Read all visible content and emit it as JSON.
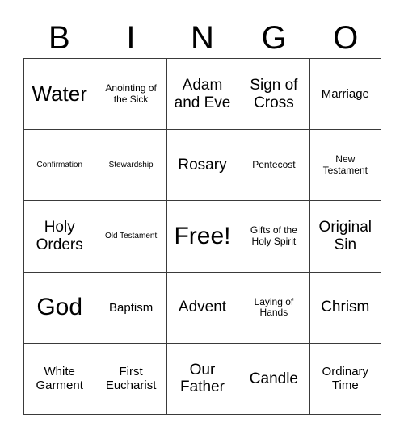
{
  "card": {
    "title": "BINGO",
    "header_letters": [
      "B",
      "I",
      "N",
      "G",
      "O"
    ],
    "grid_size": "5x5",
    "free_space": "Free!",
    "colors": {
      "background": "#ffffff",
      "text": "#000000",
      "border": "#3a3a3a"
    },
    "cells": [
      {
        "text": "Water",
        "size": "lg",
        "row": 1,
        "col": 1,
        "free": false
      },
      {
        "text": "Anointing of the Sick",
        "size": "xs",
        "row": 1,
        "col": 2,
        "free": false
      },
      {
        "text": "Adam and Eve",
        "size": "md",
        "row": 1,
        "col": 3,
        "free": false
      },
      {
        "text": "Sign of Cross",
        "size": "md",
        "row": 1,
        "col": 4,
        "free": false
      },
      {
        "text": "Marriage",
        "size": "sm",
        "row": 1,
        "col": 5,
        "free": false
      },
      {
        "text": "Confirmation",
        "size": "xxs",
        "row": 2,
        "col": 1,
        "free": false
      },
      {
        "text": "Stewardship",
        "size": "xxs",
        "row": 2,
        "col": 2,
        "free": false
      },
      {
        "text": "Rosary",
        "size": "md",
        "row": 2,
        "col": 3,
        "free": false
      },
      {
        "text": "Pentecost",
        "size": "xs",
        "row": 2,
        "col": 4,
        "free": false
      },
      {
        "text": "New Testament",
        "size": "xs",
        "row": 2,
        "col": 5,
        "free": false
      },
      {
        "text": "Holy Orders",
        "size": "md",
        "row": 3,
        "col": 1,
        "free": false
      },
      {
        "text": "Old Testament",
        "size": "xxs",
        "row": 3,
        "col": 2,
        "free": false
      },
      {
        "text": "Free!",
        "size": "xl",
        "row": 3,
        "col": 3,
        "free": true
      },
      {
        "text": "Gifts of the Holy Spirit",
        "size": "xs",
        "row": 3,
        "col": 4,
        "free": false
      },
      {
        "text": "Original Sin",
        "size": "md",
        "row": 3,
        "col": 5,
        "free": false
      },
      {
        "text": "God",
        "size": "xl",
        "row": 4,
        "col": 1,
        "free": false
      },
      {
        "text": "Baptism",
        "size": "sm",
        "row": 4,
        "col": 2,
        "free": false
      },
      {
        "text": "Advent",
        "size": "md",
        "row": 4,
        "col": 3,
        "free": false
      },
      {
        "text": "Laying of Hands",
        "size": "xs",
        "row": 4,
        "col": 4,
        "free": false
      },
      {
        "text": "Chrism",
        "size": "md",
        "row": 4,
        "col": 5,
        "free": false
      },
      {
        "text": "White Garment",
        "size": "sm",
        "row": 5,
        "col": 1,
        "free": false
      },
      {
        "text": "First Eucharist",
        "size": "sm",
        "row": 5,
        "col": 2,
        "free": false
      },
      {
        "text": "Our Father",
        "size": "md",
        "row": 5,
        "col": 3,
        "free": false
      },
      {
        "text": "Candle",
        "size": "md",
        "row": 5,
        "col": 4,
        "free": false
      },
      {
        "text": "Ordinary Time",
        "size": "sm",
        "row": 5,
        "col": 5,
        "free": false
      }
    ]
  }
}
